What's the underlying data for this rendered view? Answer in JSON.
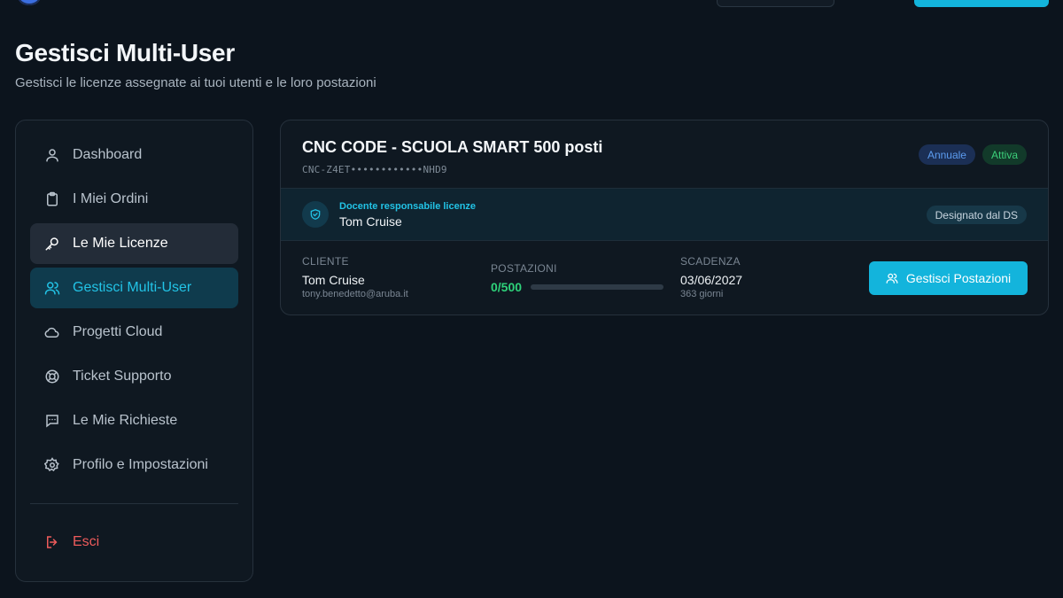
{
  "page": {
    "title": "Gestisci Multi-User",
    "subtitle": "Gestisci le licenze assegnate ai tuoi utenti e le loro postazioni"
  },
  "sidebar": {
    "items": [
      {
        "label": "Dashboard",
        "icon": "user-icon"
      },
      {
        "label": "I Miei Ordini",
        "icon": "clipboard-icon"
      },
      {
        "label": "Le Mie Licenze",
        "icon": "key-icon"
      },
      {
        "label": "Gestisci Multi-User",
        "icon": "users-icon"
      },
      {
        "label": "Progetti Cloud",
        "icon": "cloud-icon"
      },
      {
        "label": "Ticket Supporto",
        "icon": "lifebuoy-icon"
      },
      {
        "label": "Le Mie Richieste",
        "icon": "message-icon"
      },
      {
        "label": "Profilo e Impostazioni",
        "icon": "gear-icon"
      }
    ],
    "logout_label": "Esci"
  },
  "license": {
    "title": "CNC CODE - SCUOLA SMART 500 posti",
    "code": "CNC-Z4ET••••••••••••NHD9",
    "badge_plan": "Annuale",
    "badge_status": "Attiva",
    "responsible_label": "Docente responsabile licenze",
    "responsible_name": "Tom Cruise",
    "responsible_badge": "Designato dal DS",
    "client_label": "CLIENTE",
    "client_name": "Tom Cruise",
    "client_email": "tony.benedetto@aruba.it",
    "seats_label": "POSTAZIONI",
    "seats_value": "0/500",
    "seats_fraction": 0,
    "expiry_label": "SCADENZA",
    "expiry_date": "03/06/2027",
    "expiry_days": "363 giorni",
    "manage_label": "Gestisci Postazioni"
  },
  "colors": {
    "accent": "#13b4dc",
    "active_nav": "#22c3e6",
    "success": "#2ed27a",
    "danger": "#ee5b5b",
    "background": "#0c141d"
  }
}
